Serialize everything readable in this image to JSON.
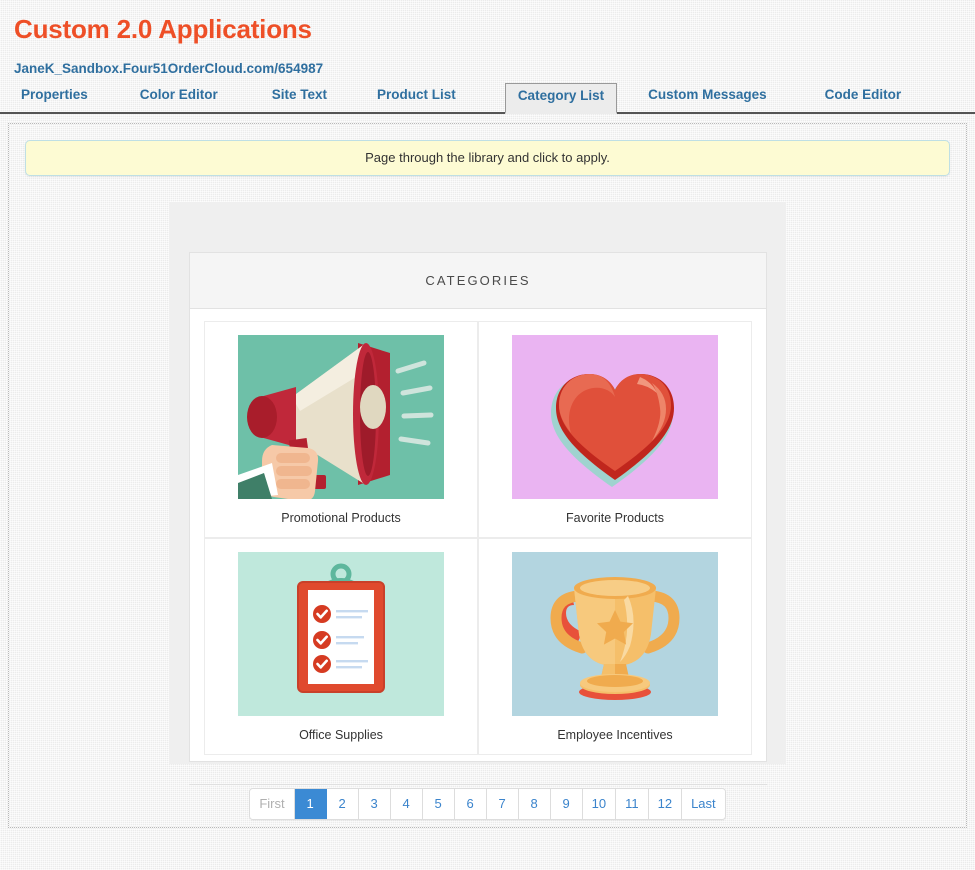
{
  "header": {
    "title": "Custom 2.0 Applications",
    "site_url": "JaneK_Sandbox.Four51OrderCloud.com/654987",
    "title_color": "#ee4f27",
    "link_color": "#2f6f9f"
  },
  "tabs": [
    {
      "label": "Properties",
      "active": false
    },
    {
      "label": "Color Editor",
      "active": false
    },
    {
      "label": "Site Text",
      "active": false
    },
    {
      "label": "Product List",
      "active": false
    },
    {
      "label": "Category List",
      "active": true
    },
    {
      "label": "Custom Messages",
      "active": false
    },
    {
      "label": "Code Editor",
      "active": false
    }
  ],
  "notice": {
    "text": "Page through the library and click to apply.",
    "background": "#fdfbd3",
    "border": "#bfdfe4"
  },
  "panel": {
    "title": "CATEGORIES"
  },
  "categories": [
    {
      "label": "Promotional Products",
      "icon": "megaphone-icon",
      "thumb_background": "#6ec0a8"
    },
    {
      "label": "Favorite Products",
      "icon": "heart-icon",
      "thumb_background": "#eab4f2"
    },
    {
      "label": "Office Supplies",
      "icon": "clipboard-checklist-icon",
      "thumb_background": "#bfe8dc"
    },
    {
      "label": "Employee Incentives",
      "icon": "trophy-icon",
      "thumb_background": "#b3d5e0"
    }
  ],
  "pagination": {
    "first_label": "First",
    "last_label": "Last",
    "pages": [
      "1",
      "2",
      "3",
      "4",
      "5",
      "6",
      "7",
      "8",
      "9",
      "10",
      "11",
      "12"
    ],
    "current_page": "1",
    "first_disabled": true,
    "active_color": "#3b8ad4",
    "link_color": "#3b84cc",
    "disabled_color": "#b0b0b0"
  }
}
